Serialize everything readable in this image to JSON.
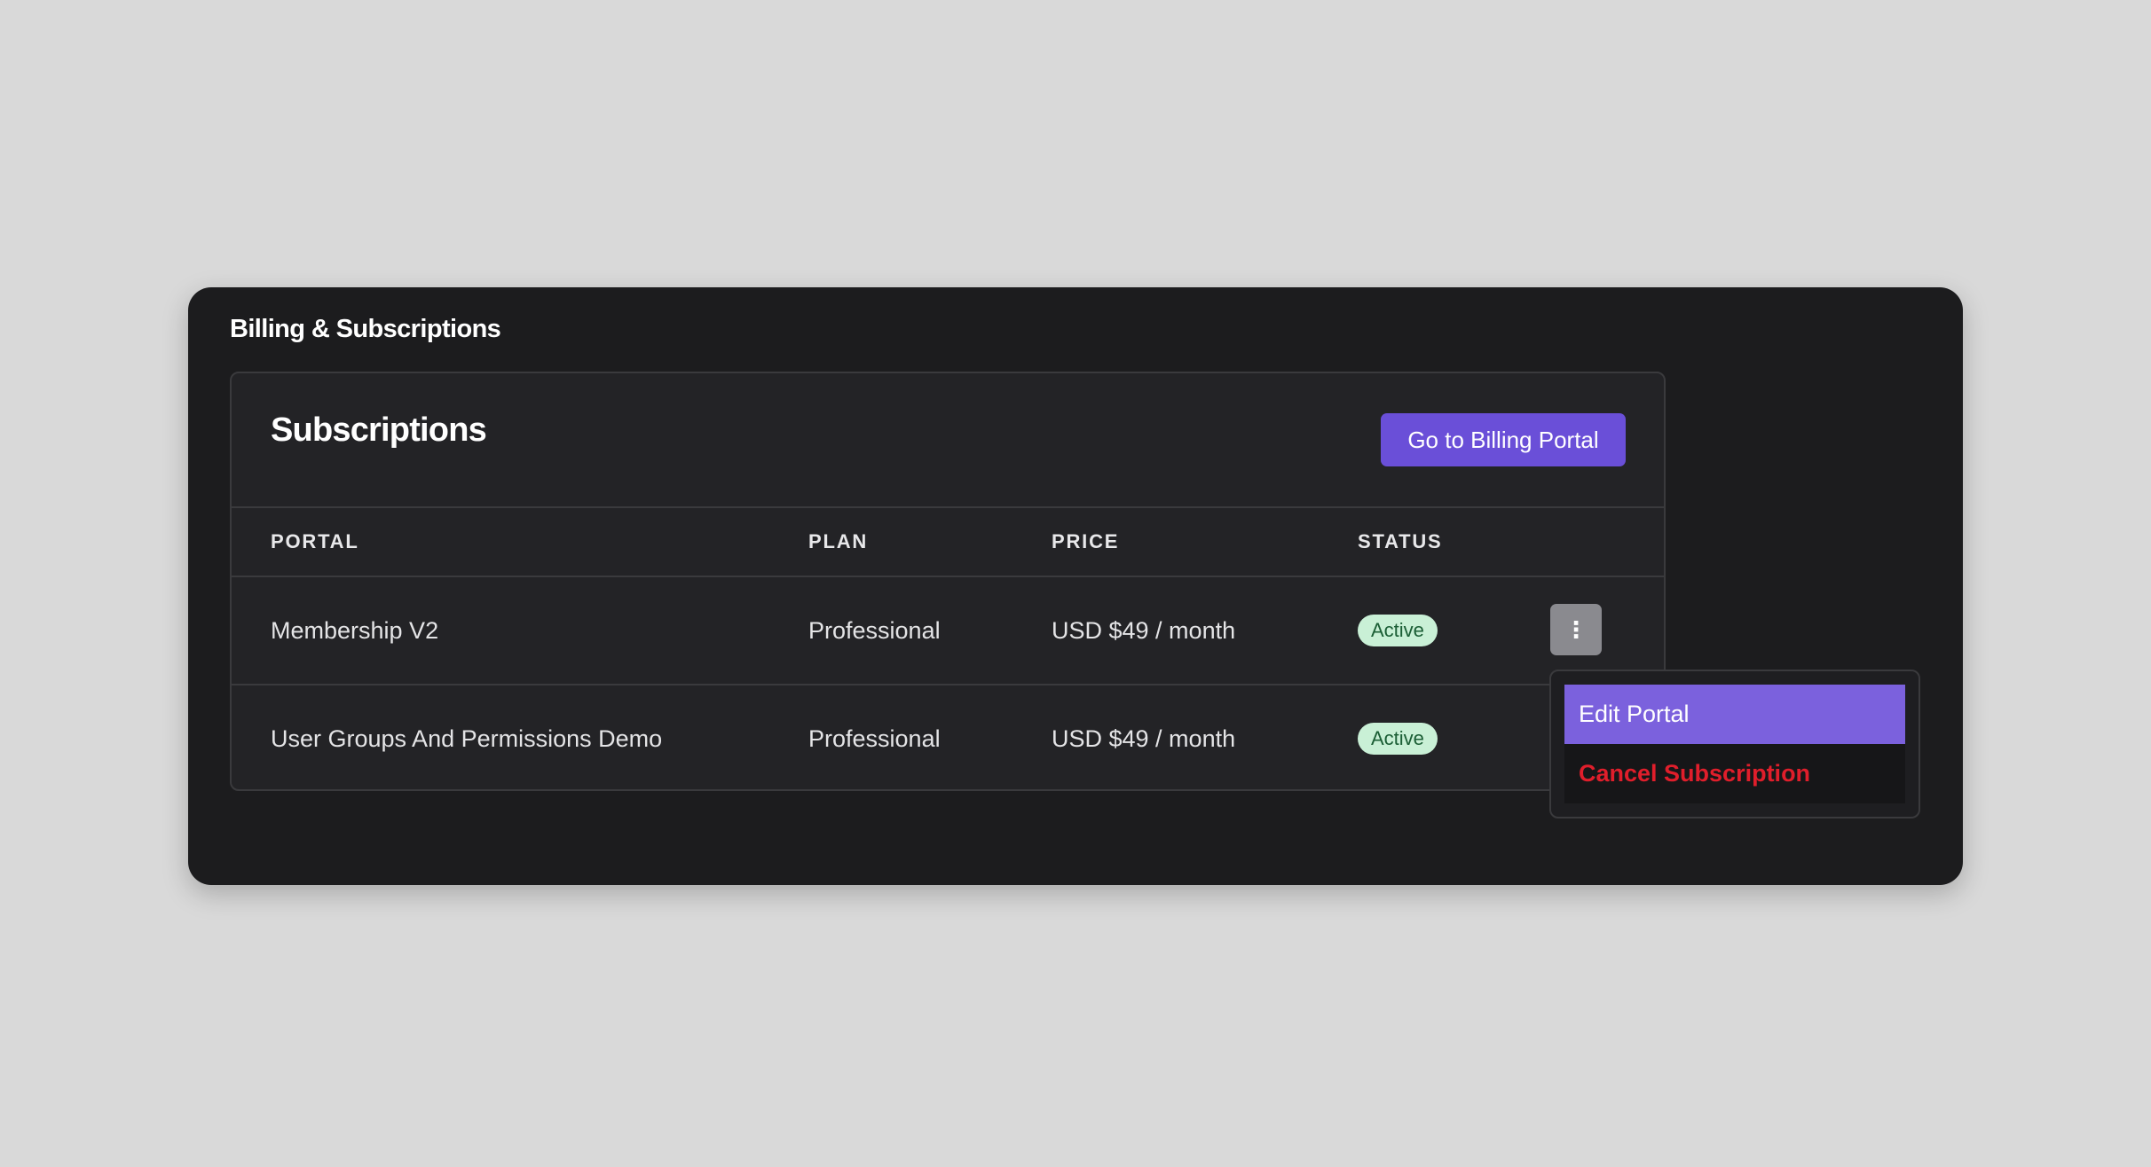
{
  "panel": {
    "title": "Billing & Subscriptions"
  },
  "subscriptions": {
    "title": "Subscriptions",
    "billing_button_label": "Go to Billing Portal",
    "columns": [
      "PORTAL",
      "PLAN",
      "PRICE",
      "STATUS"
    ],
    "rows": [
      {
        "portal": "Membership V2",
        "plan": "Professional",
        "price": "USD $49 / month",
        "status": "Active"
      },
      {
        "portal": "User Groups And Permissions Demo",
        "plan": "Professional",
        "price": "USD $49 / month",
        "status": "Active"
      }
    ],
    "row_menu_icon": "⋮"
  },
  "menu": {
    "items": [
      {
        "label": "Edit Portal"
      },
      {
        "label": "Cancel Subscription"
      }
    ]
  },
  "icons": {
    "kebab": "vertical-ellipsis-icon"
  },
  "colors": {
    "accent": "#6a4fd8",
    "menu_highlight": "#7b61dd",
    "danger": "#e01e2b",
    "badge_bg": "#c9f0d6",
    "badge_text": "#1b5e35"
  }
}
